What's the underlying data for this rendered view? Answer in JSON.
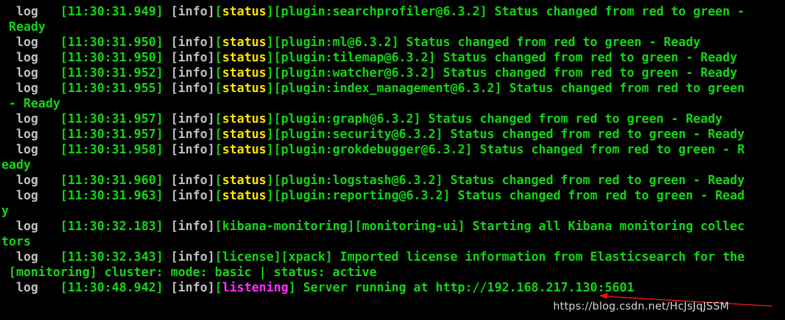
{
  "terminal": {
    "lines": [
      [
        {
          "t": "  ",
          "c": "gray"
        },
        {
          "t": "..",
          "c": "gray"
        }
      ],
      [
        {
          "t": "  log   ",
          "c": "gray"
        },
        {
          "t": "[11:30:31.949] ",
          "c": "green"
        },
        {
          "t": "[info]",
          "c": "gray"
        },
        {
          "t": "[",
          "c": "green"
        },
        {
          "t": "status",
          "c": "yellow"
        },
        {
          "t": "][plugin:searchprofiler@6.3.2] Status changed from red to green -",
          "c": "green"
        }
      ],
      [
        {
          "t": " Ready",
          "c": "green"
        }
      ],
      [
        {
          "t": "  log   ",
          "c": "gray"
        },
        {
          "t": "[11:30:31.950] ",
          "c": "green"
        },
        {
          "t": "[info]",
          "c": "gray"
        },
        {
          "t": "[",
          "c": "green"
        },
        {
          "t": "status",
          "c": "yellow"
        },
        {
          "t": "][plugin:ml@6.3.2] Status changed from red to green - Ready",
          "c": "green"
        }
      ],
      [
        {
          "t": "  log   ",
          "c": "gray"
        },
        {
          "t": "[11:30:31.950] ",
          "c": "green"
        },
        {
          "t": "[info]",
          "c": "gray"
        },
        {
          "t": "[",
          "c": "green"
        },
        {
          "t": "status",
          "c": "yellow"
        },
        {
          "t": "][plugin:tilemap@6.3.2] Status changed from red to green - Ready",
          "c": "green"
        }
      ],
      [
        {
          "t": "  log   ",
          "c": "gray"
        },
        {
          "t": "[11:30:31.952] ",
          "c": "green"
        },
        {
          "t": "[info]",
          "c": "gray"
        },
        {
          "t": "[",
          "c": "green"
        },
        {
          "t": "status",
          "c": "yellow"
        },
        {
          "t": "][plugin:watcher@6.3.2] Status changed from red to green - Ready",
          "c": "green"
        }
      ],
      [
        {
          "t": "  log   ",
          "c": "gray"
        },
        {
          "t": "[11:30:31.955] ",
          "c": "green"
        },
        {
          "t": "[info]",
          "c": "gray"
        },
        {
          "t": "[",
          "c": "green"
        },
        {
          "t": "status",
          "c": "yellow"
        },
        {
          "t": "][plugin:index_management@6.3.2] Status changed from red to green",
          "c": "green"
        }
      ],
      [
        {
          "t": " - Ready",
          "c": "green"
        }
      ],
      [
        {
          "t": "  log   ",
          "c": "gray"
        },
        {
          "t": "[11:30:31.957] ",
          "c": "green"
        },
        {
          "t": "[info]",
          "c": "gray"
        },
        {
          "t": "[",
          "c": "green"
        },
        {
          "t": "status",
          "c": "yellow"
        },
        {
          "t": "][plugin:graph@6.3.2] Status changed from red to green - Ready",
          "c": "green"
        }
      ],
      [
        {
          "t": "  log   ",
          "c": "gray"
        },
        {
          "t": "[11:30:31.957] ",
          "c": "green"
        },
        {
          "t": "[info]",
          "c": "gray"
        },
        {
          "t": "[",
          "c": "green"
        },
        {
          "t": "status",
          "c": "yellow"
        },
        {
          "t": "][plugin:security@6.3.2] Status changed from red to green - Ready",
          "c": "green"
        }
      ],
      [
        {
          "t": "  log   ",
          "c": "gray"
        },
        {
          "t": "[11:30:31.958] ",
          "c": "green"
        },
        {
          "t": "[info]",
          "c": "gray"
        },
        {
          "t": "[",
          "c": "green"
        },
        {
          "t": "status",
          "c": "yellow"
        },
        {
          "t": "][plugin:grokdebugger@6.3.2] Status changed from red to green - R",
          "c": "green"
        }
      ],
      [
        {
          "t": "eady",
          "c": "green"
        }
      ],
      [
        {
          "t": "  log   ",
          "c": "gray"
        },
        {
          "t": "[11:30:31.960] ",
          "c": "green"
        },
        {
          "t": "[info]",
          "c": "gray"
        },
        {
          "t": "[",
          "c": "green"
        },
        {
          "t": "status",
          "c": "yellow"
        },
        {
          "t": "][plugin:logstash@6.3.2] Status changed from red to green - Ready",
          "c": "green"
        }
      ],
      [
        {
          "t": "  log   ",
          "c": "gray"
        },
        {
          "t": "[11:30:31.963] ",
          "c": "green"
        },
        {
          "t": "[info]",
          "c": "gray"
        },
        {
          "t": "[",
          "c": "green"
        },
        {
          "t": "status",
          "c": "yellow"
        },
        {
          "t": "][plugin:reporting@6.3.2] Status changed from red to green - Read",
          "c": "green"
        }
      ],
      [
        {
          "t": "y",
          "c": "green"
        }
      ],
      [
        {
          "t": "  log   ",
          "c": "gray"
        },
        {
          "t": "[11:30:32.183] ",
          "c": "green"
        },
        {
          "t": "[info]",
          "c": "gray"
        },
        {
          "t": "[kibana-monitoring][monitoring-ui] Starting all Kibana monitoring collec",
          "c": "green"
        }
      ],
      [
        {
          "t": "tors",
          "c": "green"
        }
      ],
      [
        {
          "t": "  log   ",
          "c": "gray"
        },
        {
          "t": "[11:30:32.343] ",
          "c": "green"
        },
        {
          "t": "[info]",
          "c": "gray"
        },
        {
          "t": "[license][xpack] Imported license information from Elasticsearch for the",
          "c": "green"
        }
      ],
      [
        {
          "t": " [monitoring] cluster: mode: basic | status: active",
          "c": "green"
        }
      ],
      [
        {
          "t": "  log   ",
          "c": "gray"
        },
        {
          "t": "[11:30:48.942] ",
          "c": "green"
        },
        {
          "t": "[info]",
          "c": "gray"
        },
        {
          "t": "[",
          "c": "green"
        },
        {
          "t": "listening",
          "c": "magenta"
        },
        {
          "t": "] Server running at http://192.168.217.130:5601",
          "c": "green"
        }
      ]
    ]
  },
  "watermark": "https://blog.csdn.net/HcJsJqJSSM",
  "colors": {
    "background": "#000000",
    "gray": "#c0c0c0",
    "green": "#13d613",
    "yellow": "#ffe600",
    "magenta": "#ff30ff",
    "arrow": "#e01818"
  },
  "icons": {
    "arrow": "red-arrow-icon"
  }
}
